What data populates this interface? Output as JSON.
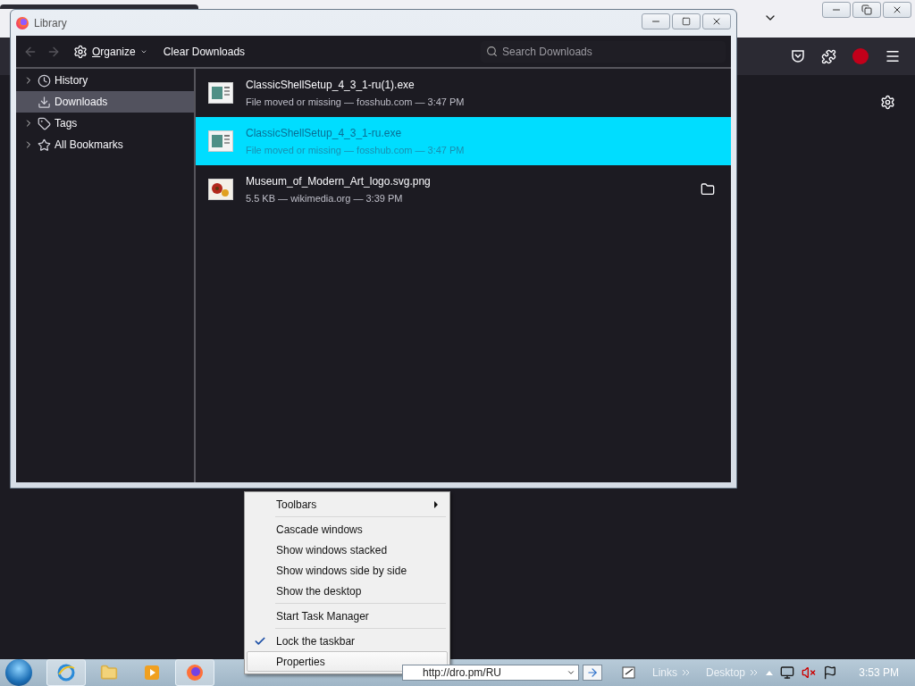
{
  "library": {
    "title": "Library",
    "organize": "Organize",
    "clear_button": "Clear Downloads",
    "search": {
      "placeholder": "Search Downloads"
    },
    "sidebar": [
      {
        "label": "History",
        "kind": "history",
        "expandable": true,
        "selected": false
      },
      {
        "label": "Downloads",
        "kind": "downloads",
        "expandable": false,
        "selected": true
      },
      {
        "label": "Tags",
        "kind": "tags",
        "expandable": true,
        "selected": false
      },
      {
        "label": "All Bookmarks",
        "kind": "bookmarks",
        "expandable": true,
        "selected": false
      }
    ],
    "downloads": [
      {
        "name": "ClassicShellSetup_4_3_1-ru(1).exe",
        "status": "File moved or missing — fosshub.com — 3:47 PM",
        "kind": "exe",
        "selected": false,
        "show_folder": false
      },
      {
        "name": "ClassicShellSetup_4_3_1-ru.exe",
        "status": "File moved or missing — fosshub.com — 3:47 PM",
        "kind": "exe",
        "selected": true,
        "show_folder": false
      },
      {
        "name": "Museum_of_Modern_Art_logo.svg.png",
        "status": "5.5 KB — wikimedia.org — 3:39 PM",
        "kind": "image",
        "selected": false,
        "show_folder": true
      }
    ]
  },
  "context_menu": {
    "items": [
      {
        "label": "Toolbars",
        "kind": "submenu",
        "checked": false,
        "selected": false
      },
      {
        "kind": "separator"
      },
      {
        "label": "Cascade windows",
        "kind": "item",
        "checked": false,
        "selected": false
      },
      {
        "label": "Show windows stacked",
        "kind": "item",
        "checked": false,
        "selected": false
      },
      {
        "label": "Show windows side by side",
        "kind": "item",
        "checked": false,
        "selected": false
      },
      {
        "label": "Show the desktop",
        "kind": "item",
        "checked": false,
        "selected": false
      },
      {
        "kind": "separator"
      },
      {
        "label": "Start Task Manager",
        "kind": "item",
        "checked": false,
        "selected": false
      },
      {
        "kind": "separator"
      },
      {
        "label": "Lock the taskbar",
        "kind": "item",
        "checked": true,
        "selected": false
      },
      {
        "label": "Properties",
        "kind": "item",
        "checked": false,
        "selected": true
      }
    ]
  },
  "taskbar": {
    "apps": [
      {
        "kind": "ie",
        "selected": true
      },
      {
        "kind": "folder",
        "selected": false
      },
      {
        "kind": "media",
        "selected": false
      },
      {
        "kind": "firefox",
        "selected": true
      }
    ],
    "address": "http://dro.pm/RU",
    "toolbars": [
      "Links",
      "Desktop"
    ],
    "clock": "3:53 PM"
  }
}
